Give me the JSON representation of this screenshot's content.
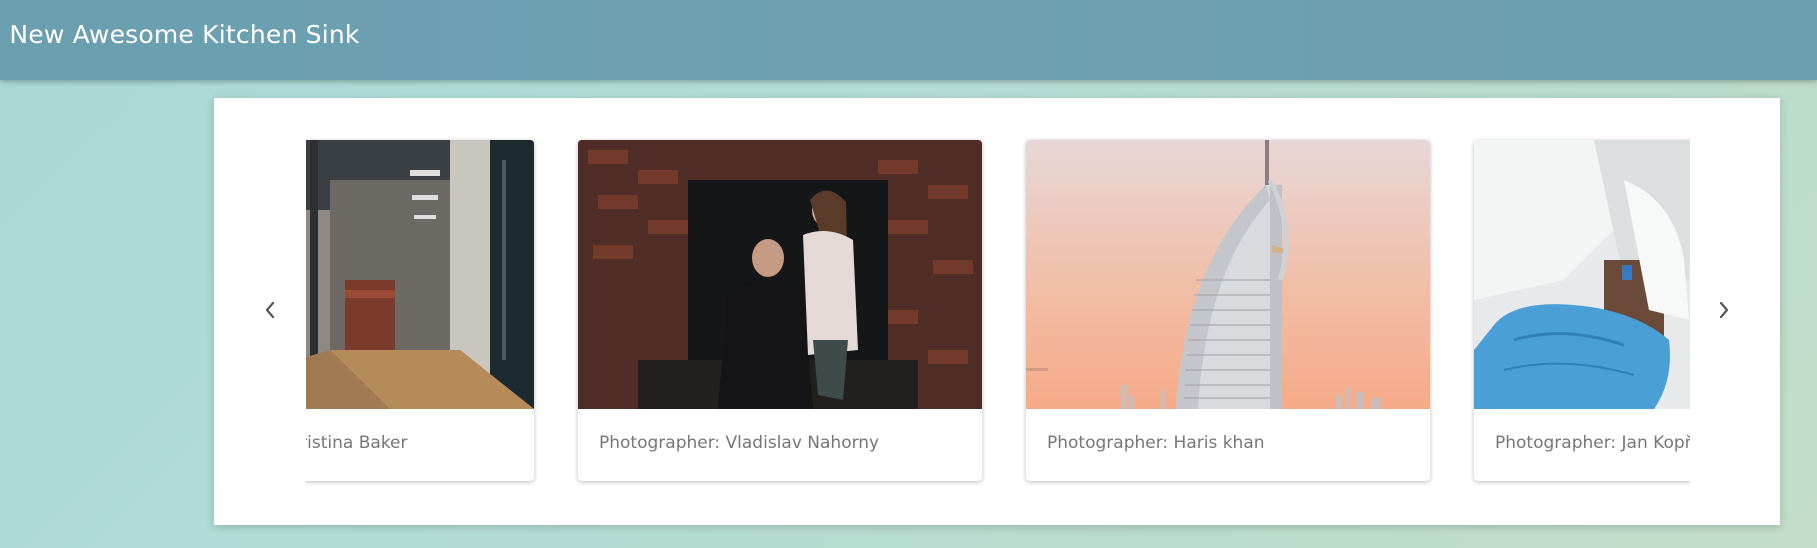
{
  "header": {
    "title": "- New Awesome Kitchen Sink"
  },
  "carousel": {
    "prev_icon": "chevron-left-icon",
    "next_icon": "chevron-right-icon",
    "cards": [
      {
        "caption": "Photographer: Christina Baker",
        "image": "office-hallway-photo"
      },
      {
        "caption": "Photographer: Vladislav Nahorny",
        "image": "fireplace-portrait-photo"
      },
      {
        "caption": "Photographer: Haris khan",
        "image": "burj-al-arab-sunset-photo"
      },
      {
        "caption": "Photographer: Jan Kopřiva",
        "image": "blue-gloves-photo"
      }
    ]
  },
  "colors": {
    "topbar": "#6ea2b3",
    "background": "#b3dcd6",
    "caption_text": "#777777",
    "nav_icon": "#555555"
  }
}
